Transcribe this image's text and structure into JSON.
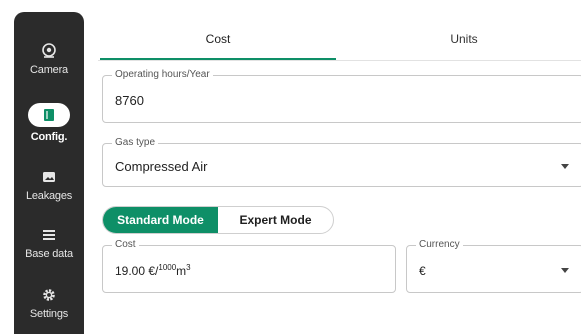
{
  "sidebar": {
    "items": [
      {
        "label": "Camera",
        "icon": "camera-icon"
      },
      {
        "label": "Config.",
        "icon": "book-icon",
        "active": true
      },
      {
        "label": "Leakages",
        "icon": "image-icon"
      },
      {
        "label": "Base data",
        "icon": "list-icon"
      },
      {
        "label": "Settings",
        "icon": "gear-icon"
      }
    ]
  },
  "tabs": [
    {
      "label": "Cost",
      "active": true
    },
    {
      "label": "Units",
      "active": false
    }
  ],
  "form": {
    "operating_hours": {
      "label": "Operating hours/Year",
      "value": "8760"
    },
    "gas_type": {
      "label": "Gas type",
      "value": "Compressed Air"
    },
    "mode": {
      "standard": "Standard Mode",
      "expert": "Expert Mode",
      "selected": "Standard Mode"
    },
    "cost": {
      "label": "Cost",
      "value_prefix": "19.00 €/",
      "value_sup": "1000",
      "value_unit": "m",
      "value_unit_sup": "3"
    },
    "currency": {
      "label": "Currency",
      "value": "€"
    }
  },
  "colors": {
    "accent": "#0e8f67",
    "sidebar": "#2b2b2b"
  }
}
